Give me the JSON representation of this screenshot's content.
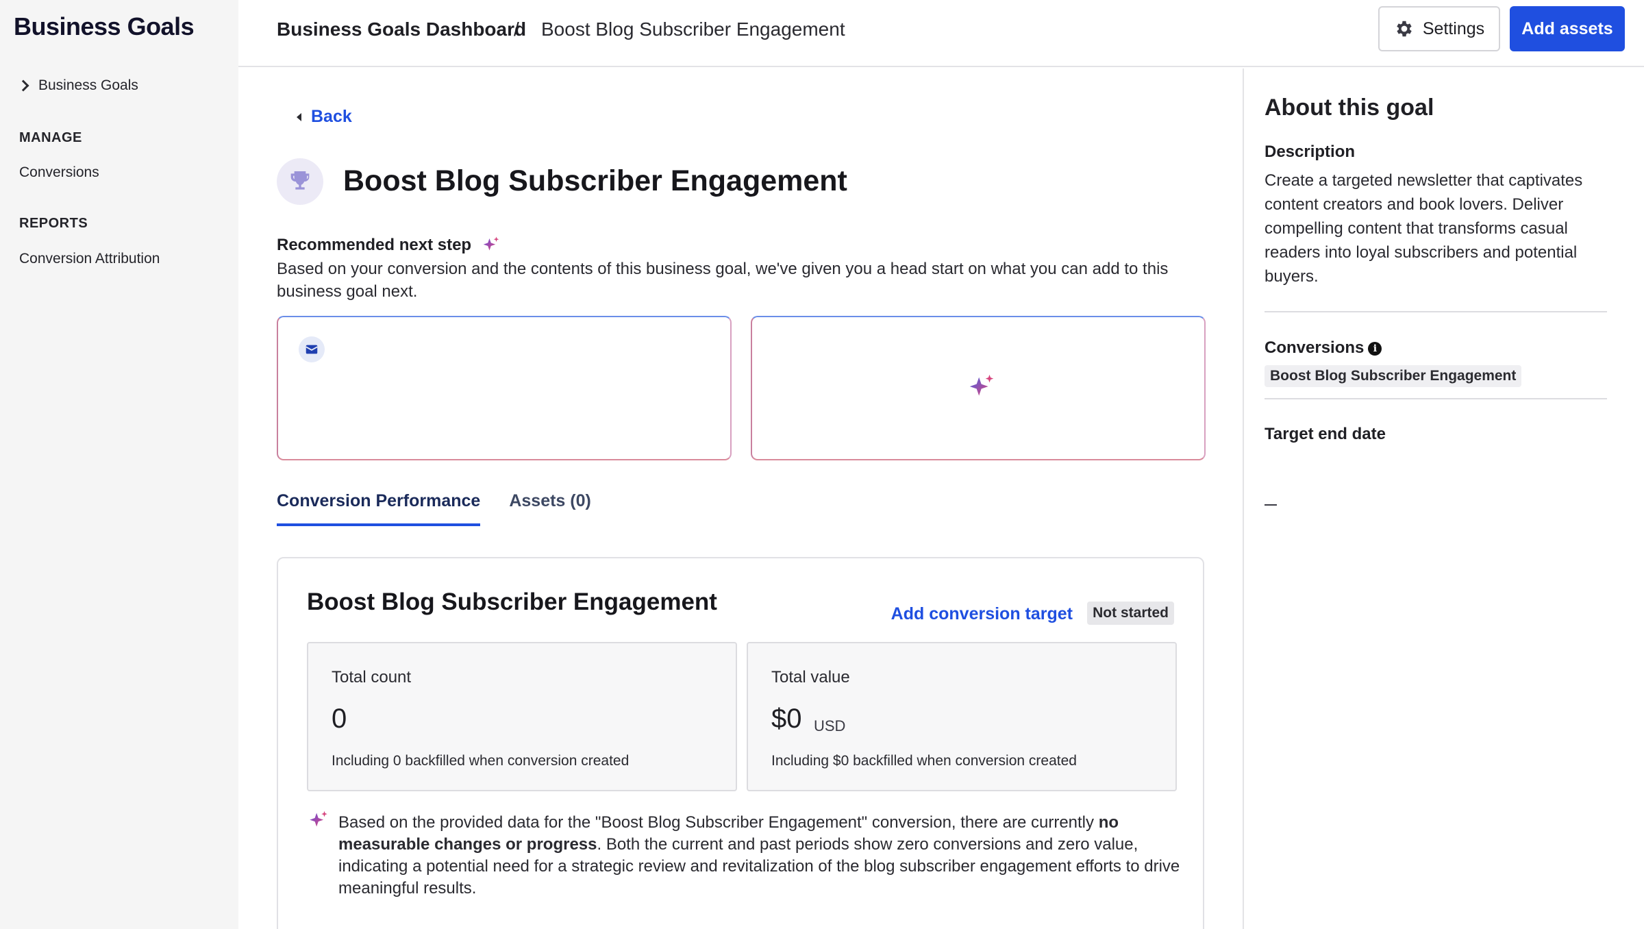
{
  "sidebar": {
    "brand": "Business Goals",
    "nav_root": "Business Goals",
    "manage_heading": "MANAGE",
    "manage_items": [
      "Conversions"
    ],
    "reports_heading": "REPORTS",
    "reports_items": [
      "Conversion Attribution"
    ]
  },
  "topbar": {
    "breadcrumb_root": "Business Goals Dashboard",
    "breadcrumb_sep": "/",
    "breadcrumb_current": "Boost Blog Subscriber Engagement",
    "settings_label": "Settings",
    "add_assets_label": "Add assets"
  },
  "main": {
    "back_label": "Back",
    "goal_title": "Boost Blog Subscriber Engagement",
    "recommended": {
      "heading": "Recommended next step",
      "description": "Based on your conversion and the contents of this business goal, we've given you a head start on what you can add to this business goal next."
    },
    "tabs": [
      {
        "label": "Conversion Performance"
      },
      {
        "label": "Assets (0)"
      }
    ],
    "performance": {
      "title": "Boost Blog Subscriber Engagement",
      "add_target_label": "Add conversion target",
      "status": "Not started",
      "total_count": {
        "label": "Total count",
        "value": "0",
        "note": "Including 0 backfilled when conversion created"
      },
      "total_value": {
        "label": "Total value",
        "value": "$0",
        "unit": "USD",
        "note": "Including $0 backfilled when conversion created"
      },
      "summary": {
        "before": "Based on the provided data for the \"Boost Blog Subscriber Engagement\" conversion, there are currently ",
        "bold": "no measurable changes or progress",
        "after": ". Both the current and past periods show zero conversions and zero value, indicating a potential need for a strategic review and revitalization of the blog subscriber engagement efforts to drive meaningful results."
      }
    }
  },
  "right_panel": {
    "title": "About this goal",
    "description_label": "Description",
    "description": "Create a targeted newsletter that captivates content creators and book lovers. Deliver compelling content that transforms casual readers into loyal subscribers and potential buyers.",
    "conversions_label": "Conversions",
    "conversions": [
      "Boost Blog Subscriber Engagement"
    ],
    "target_end_label": "Target end date"
  },
  "colors": {
    "accent": "#1f4fe0",
    "sidebar_bg": "#f5f5f5",
    "spark_pink": "#d6457e",
    "spark_purple": "#6b4fd8"
  },
  "icons": [
    "chevron-right-icon",
    "gear-icon",
    "caret-left-icon",
    "trophy-icon",
    "sparkle-icon",
    "mail-icon",
    "info-icon"
  ]
}
